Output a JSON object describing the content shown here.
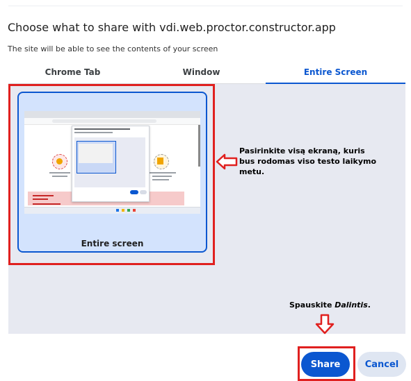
{
  "dialog": {
    "title": "Choose what to share with vdi.web.proctor.constructor.app",
    "subtitle": "The site will be able to see the contents of your screen"
  },
  "tabs": [
    {
      "label": "Chrome Tab",
      "selected": false
    },
    {
      "label": "Window",
      "selected": false
    },
    {
      "label": "Entire Screen",
      "selected": true
    }
  ],
  "screen_option": {
    "label": "Entire screen",
    "selected": true
  },
  "annotations": {
    "screen_hint": "Pasirinkite visą ekraną, kuris bus rodomas viso testo laikymo metu.",
    "share_hint_prefix": "Spauskite ",
    "share_hint_emph": "Dalintis",
    "share_hint_suffix": "."
  },
  "buttons": {
    "share": "Share",
    "cancel": "Cancel"
  },
  "colors": {
    "accent": "#0b57d0",
    "highlight_red": "#e0201f",
    "panel_bg": "#e7e9f1",
    "card_bg": "#d3e3fd"
  }
}
